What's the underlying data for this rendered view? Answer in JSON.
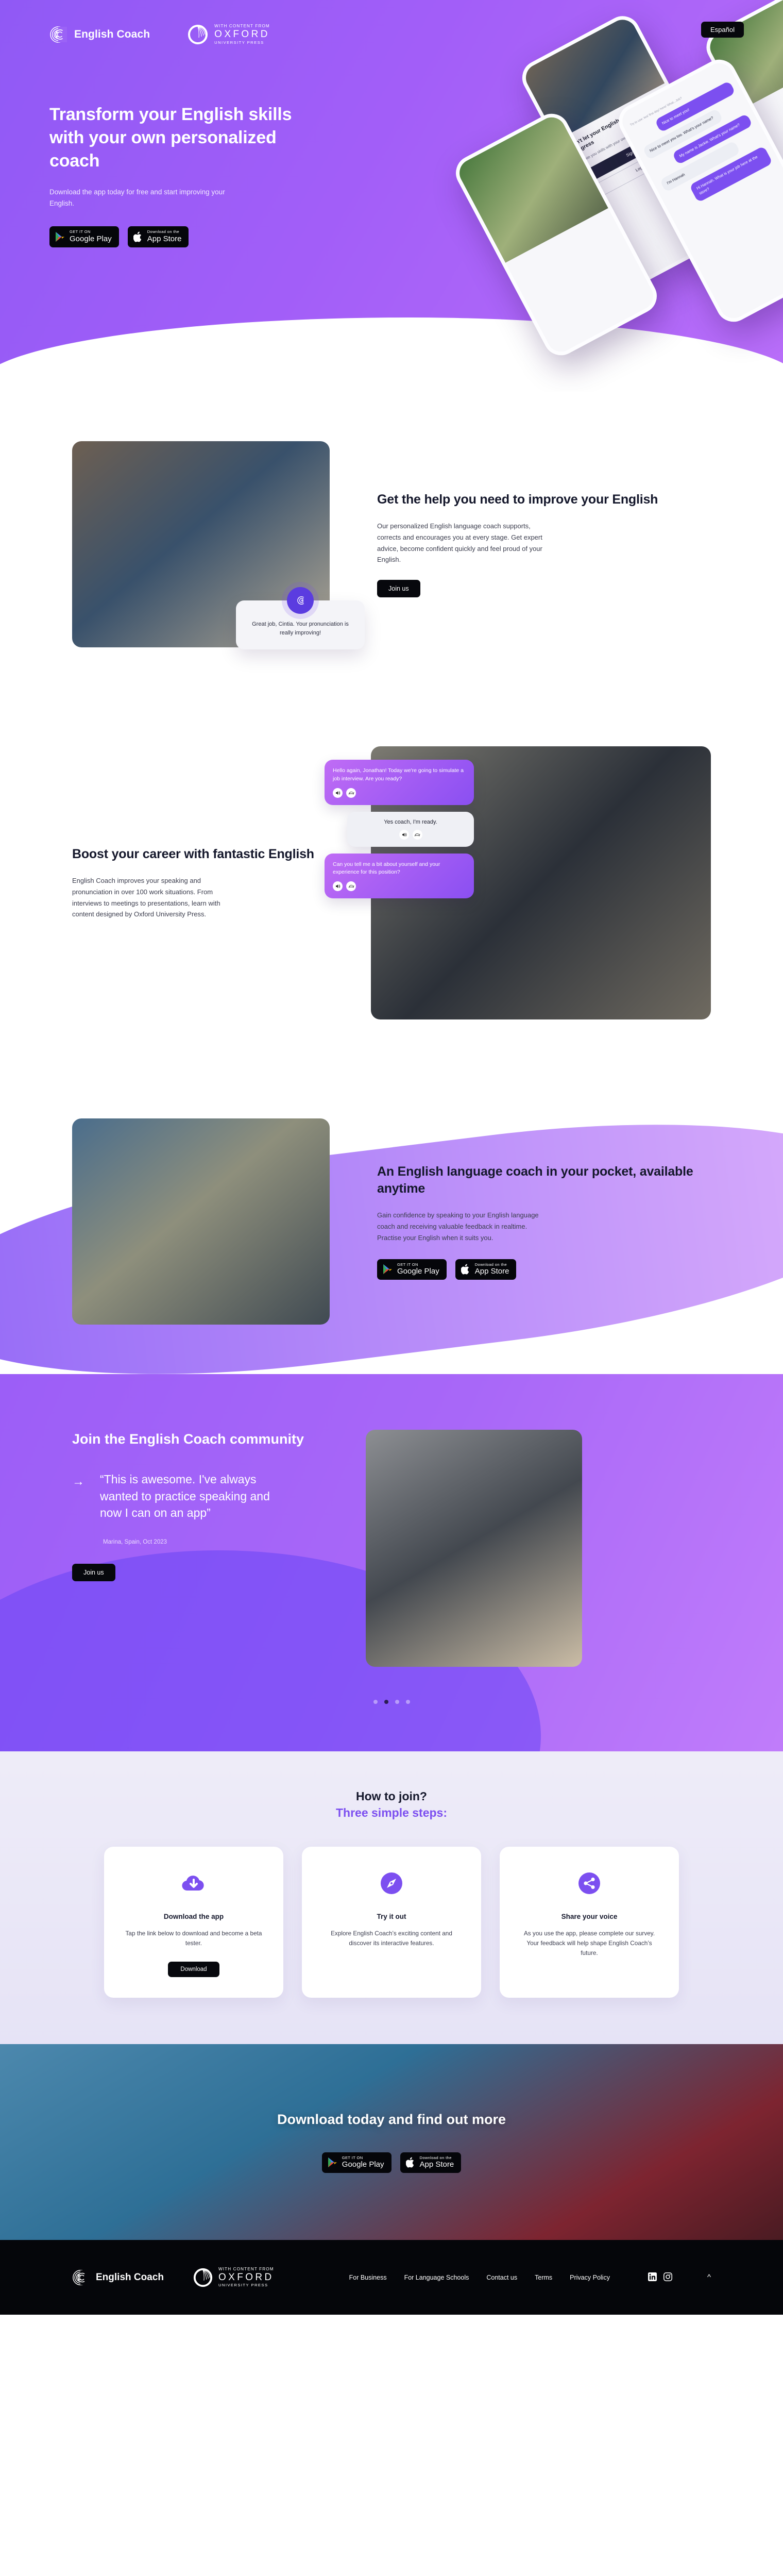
{
  "brand": {
    "name": "English Coach",
    "partner": {
      "line1": "WITH CONTENT FROM",
      "line2": "OXFORD",
      "line3": "UNIVERSITY PRESS"
    }
  },
  "hero": {
    "lang_button": "Español",
    "title": "Transform your English skills with your own personalized coach",
    "subtitle": "Download the app today for free and start improving your English.",
    "badges": [
      {
        "small": "GET IT ON",
        "large": "Google Play",
        "icon": "google-play-icon"
      },
      {
        "small": "Download on the",
        "large": "App Store",
        "icon": "apple-icon"
      }
    ],
    "mockups": {
      "signup_screen": {
        "heading": "Don't let your English stop your career progress",
        "body": "Elevate you skills with your own personalised coach.",
        "primary": "Sign up",
        "secondary": "Log in"
      },
      "chat_screen": {
        "hint": "Try to use: tea/ first day/ here/ What...Job?",
        "messages": [
          {
            "from": "coach",
            "text": "Nice to meet you!"
          },
          {
            "from": "user",
            "text": "Nice to meet you too. What's your name?"
          },
          {
            "from": "coach",
            "text": "My name is Jackie. What's your name?"
          },
          {
            "from": "user",
            "text": "I'm Hannah"
          },
          {
            "from": "coach",
            "text": "Hi Hannah. What is your job here at the store?"
          }
        ]
      }
    }
  },
  "section_help": {
    "title": "Get the help you need to improve your English",
    "body": "Our personalized English language coach supports, corrects and encourages you at every stage. Get expert advice, become confident quickly and feel proud of your English.",
    "cta": "Join us",
    "bubble": "Great job, Cintia. Your pronunciation is really improving!"
  },
  "section_career": {
    "title": "Boost your career with fantastic English",
    "body": "English Coach improves your speaking and pronunciation in over 100 work situations. From interviews to meetings to presentations, learn with content designed by Oxford University Press.",
    "chat": [
      {
        "from": "coach",
        "text": "Hello again, Jonathan! Today we're going to simulate a job interview. Are you ready?"
      },
      {
        "from": "user",
        "text": "Yes coach, I'm ready."
      },
      {
        "from": "coach",
        "text": "Can you tell me a bit about yourself and your experience for this position?"
      }
    ],
    "bubble_icons": [
      "speaker-icon",
      "turtle-slow-icon"
    ]
  },
  "section_pocket": {
    "title": "An English language coach in your pocket, available anytime",
    "body": "Gain confidence by speaking to your English language coach and receiving valuable feedback in realtime. Practise your English when it suits you.",
    "badges": [
      {
        "small": "GET IT ON",
        "large": "Google Play",
        "icon": "google-play-icon"
      },
      {
        "small": "Download on the",
        "large": "App Store",
        "icon": "apple-icon"
      }
    ]
  },
  "testimonial": {
    "heading": "Join the English Coach community",
    "arrow": "→",
    "quote": "“This is awesome. I've always wanted to practice speaking and now I can on an app”",
    "attribution": "Marina, Spain, Oct 2023",
    "cta": "Join us",
    "dots": {
      "count": 4,
      "active_index": 1
    }
  },
  "how_to_join": {
    "heading": "How to join?",
    "subheading": "Three simple steps:",
    "accent_color": "#7C4FF0",
    "cards": [
      {
        "icon": "cloud-download-icon",
        "title": "Download the app",
        "body": "Tap the link below to download and become a beta tester.",
        "button": "Download"
      },
      {
        "icon": "compass-icon",
        "title": "Try it out",
        "body": "Explore English Coach’s exciting content and discover its interactive features.",
        "button": ""
      },
      {
        "icon": "share-icon",
        "title": "Share your voice",
        "body": "As you use the app, please complete our survey. Your feedback will help shape English Coach’s future.",
        "button": ""
      }
    ]
  },
  "final_cta": {
    "heading": "Download today and find out more",
    "badges": [
      {
        "small": "GET IT ON",
        "large": "Google Play",
        "icon": "google-play-icon"
      },
      {
        "small": "Download on the",
        "large": "App Store",
        "icon": "apple-icon"
      }
    ]
  },
  "footer": {
    "brand": "English Coach",
    "links": [
      "For Business",
      "For Language Schools",
      "Contact us",
      "Terms",
      "Privacy Policy"
    ],
    "social": [
      "linkedin-icon",
      "instagram-icon"
    ],
    "back_to_top": "^"
  }
}
